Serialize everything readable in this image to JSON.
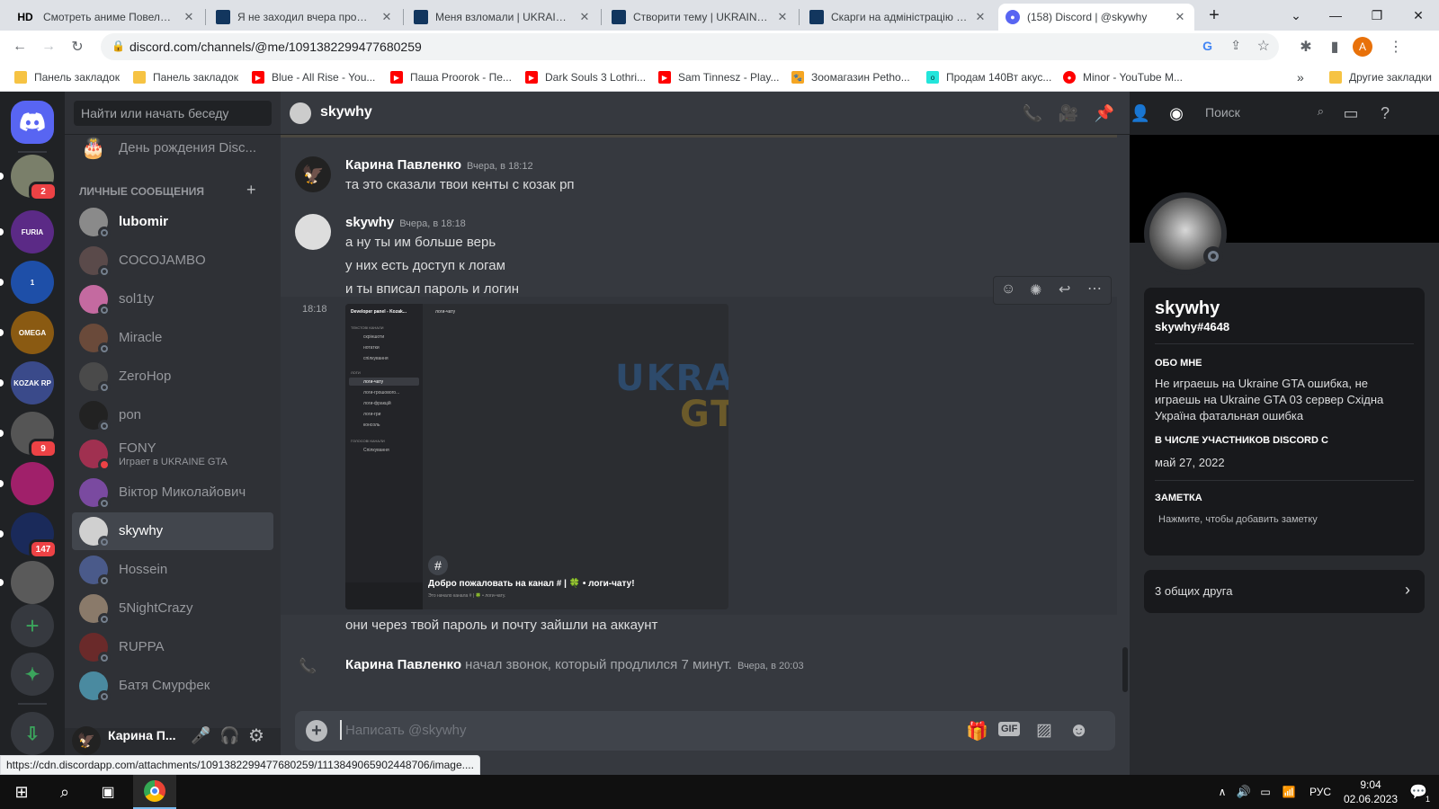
{
  "browser": {
    "tabs": [
      {
        "favicon": "HD",
        "title": "Смотреть аниме Повелитель"
      },
      {
        "favicon": "ua",
        "title": "Я не заходил вчера прошу р"
      },
      {
        "favicon": "ua",
        "title": "Меня взломали | UKRAINE G"
      },
      {
        "favicon": "ua",
        "title": "Створити тему | UKRAINE GT"
      },
      {
        "favicon": "ua",
        "title": "Скарги на адміністрацію | U"
      },
      {
        "favicon": "discord",
        "title": "(158) Discord | @skywhy"
      }
    ],
    "new_tab": "+",
    "url": "discord.com/channels/@me/1091382299477680259",
    "profile_initial": "A",
    "bookmarks": [
      {
        "icon": "folder",
        "label": "Панель закладок"
      },
      {
        "icon": "folder",
        "label": "Панель закладок"
      },
      {
        "icon": "youtube",
        "label": "Blue - All Rise - You..."
      },
      {
        "icon": "youtube",
        "label": "Паша Proorok - Пе..."
      },
      {
        "icon": "youtube",
        "label": "Dark Souls 3 Lothri..."
      },
      {
        "icon": "youtube",
        "label": "Sam Tinnesz - Play..."
      },
      {
        "icon": "petshop",
        "label": "Зоомагазин Petho..."
      },
      {
        "icon": "olx",
        "label": "Продам 140Вт акус..."
      },
      {
        "icon": "music",
        "label": "Minor - YouTube M..."
      }
    ],
    "bookmarks_more": "»",
    "other_bookmarks": "Другие закладки",
    "status_url": "https://cdn.discordapp.com/attachments/1091382299477680259/1113849065902448706/image...."
  },
  "guilds": [
    {
      "label": "",
      "badge": "2",
      "color": "#7a7f6a"
    },
    {
      "label": "FURIA",
      "badge": "",
      "color": "#5b2a86"
    },
    {
      "label": "1",
      "badge": "",
      "color": "#1e4fa8"
    },
    {
      "label": "OMEGA",
      "badge": "",
      "color": "#8a5a12"
    },
    {
      "label": "KOZAK RP",
      "badge": "",
      "color": "#3a4a8a"
    },
    {
      "label": "",
      "badge": "9",
      "color": "#555"
    },
    {
      "label": "",
      "badge": "",
      "color": "#a0206a"
    },
    {
      "label": "",
      "badge": "147",
      "color": "#1a2a5a"
    },
    {
      "label": "",
      "badge": "",
      "color": "#5a5a5a"
    }
  ],
  "dm_panel": {
    "search_placeholder": "Найти или начать беседу",
    "birthday": "День рождения Disc...",
    "section_title": "ЛИЧНЫЕ СООБЩЕНИЯ",
    "add": "+",
    "items": [
      {
        "name": "lubomir",
        "sub": "",
        "status": "offline",
        "color": "#8a8a8a",
        "bold": true
      },
      {
        "name": "COCOJAMBO",
        "sub": "",
        "status": "offline",
        "color": "#5a4a4a"
      },
      {
        "name": "sol1ty",
        "sub": "",
        "status": "offline",
        "color": "#c46aa0"
      },
      {
        "name": "Miracle",
        "sub": "",
        "status": "offline",
        "color": "#6a4a3a"
      },
      {
        "name": "ZeroHop",
        "sub": "",
        "status": "offline",
        "color": "#4a4a4a"
      },
      {
        "name": "pon",
        "sub": "",
        "status": "offline",
        "color": "#222"
      },
      {
        "name": "FONY",
        "sub": "Играет в UKRAINE GTA",
        "status": "dnd",
        "color": "#a03050"
      },
      {
        "name": "Віктор Миколайович",
        "sub": "",
        "status": "offline",
        "color": "#7a4aa0"
      },
      {
        "name": "skywhy",
        "sub": "",
        "status": "offline",
        "color": "#d0d0d0",
        "selected": true
      },
      {
        "name": "Hossein",
        "sub": "",
        "status": "offline",
        "color": "#4a5a8a"
      },
      {
        "name": "5NightCrazy",
        "sub": "",
        "status": "offline",
        "color": "#8a7a6a"
      },
      {
        "name": "RUPPA",
        "sub": "",
        "status": "offline",
        "color": "#6a2a2a"
      },
      {
        "name": "Батя Смурфек",
        "sub": "",
        "status": "offline",
        "color": "#4a8aa0"
      }
    ]
  },
  "user_panel": {
    "name": "Карина П..."
  },
  "chat": {
    "channel_name": "skywhy",
    "search_placeholder": "Поиск",
    "composer_placeholder": "Написать @skywhy",
    "messages": [
      {
        "author": "Карина Павленко",
        "time": "Вчера, в 18:12",
        "lines": [
          "та это сказали твои кенты с козак рп"
        ]
      },
      {
        "author": "skywhy",
        "time": "Вчера, в 18:18",
        "lines": [
          "а ну ты им больше верь",
          "у них есть доступ к логам",
          "и ты вписал пароль и логин"
        ]
      }
    ],
    "attachment_time": "18:18",
    "attachment": {
      "panel_title": "Developer panel - Kozak...",
      "channel": "логи-чату",
      "cat1": "ТЕКСТОВІ КАНАЛИ",
      "ch1": [
        "скріншоти",
        "нотатки",
        "спілкування"
      ],
      "cat2": "ЛОГИ",
      "ch2": [
        "логи-чату",
        "логи-грошового...",
        "логи-фракцій",
        "логи-гри",
        "консоль"
      ],
      "cat3": "ГОЛОСОВІ КАНАЛИ",
      "ch3": [
        "Спілкування"
      ],
      "watermark1": "UKRAINE",
      "watermark2": "GTA",
      "welcome": "Добро пожаловать на канал # | 🍀 • логи-чату!",
      "welcome_sub": "Это начало канала # | 🍀 • логи-чату."
    },
    "after_line": "они через твой пароль и почту зайшли на аккаунт",
    "call": {
      "author": "Карина Павленко",
      "text": "начал звонок, который продлился 7 минут.",
      "time": "Вчера, в 20:03"
    }
  },
  "profile": {
    "display_name": "skywhy",
    "tag": "skywhy#4648",
    "about_label": "ОБО МНЕ",
    "about_text": "Не играешь на Ukraine GTA ошибка, не играешь на Ukraine GTA 03 сервер Східна Україна фатальная ошибка",
    "member_label": "В ЧИСЛЕ УЧАСТНИКОВ DISCORD С",
    "member_since": "май 27, 2022",
    "note_label": "ЗАМЕТКА",
    "note_placeholder": "Нажмите, чтобы добавить заметку",
    "mutual_friends": "3 общих друга"
  },
  "taskbar": {
    "lang": "РУС",
    "time": "9:04",
    "date": "02.06.2023",
    "notifications": "1"
  },
  "colors": {
    "blurple": "#5865f2",
    "green": "#3ba55c",
    "red": "#ed4245"
  }
}
